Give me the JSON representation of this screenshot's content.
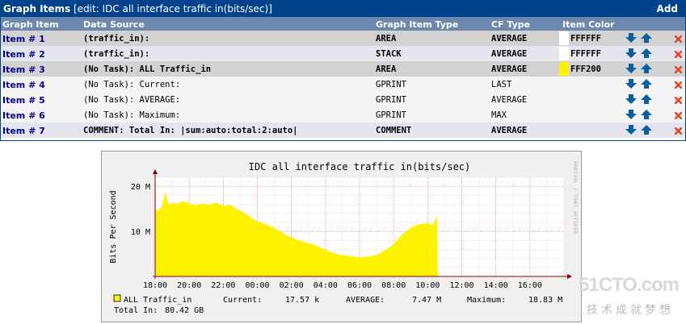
{
  "panel": {
    "title_bold": "Graph Items",
    "title_rest": "[edit: IDC all interface traffic in(bits/sec)]",
    "add_label": "Add",
    "headers": [
      "Graph Item",
      "Data Source",
      "Graph Item Type",
      "CF Type",
      "Item Color"
    ],
    "rows": [
      {
        "item": "Item # 1",
        "ds": "(traffic_in):",
        "type": "AREA",
        "cf": "AVERAGE",
        "color_hex": "FFFFFF",
        "swatch": "#ffffff",
        "bg": "#d2d2d2",
        "bold": true
      },
      {
        "item": "Item # 2",
        "ds": "(traffic_in):",
        "type": "STACK",
        "cf": "AVERAGE",
        "color_hex": "FFFFFF",
        "swatch": "#ffffff",
        "bg": "#e5e5f0",
        "bold": true
      },
      {
        "item": "Item # 3",
        "ds": "(No Task): ALL Traffic_in",
        "type": "AREA",
        "cf": "AVERAGE",
        "color_hex": "FFF200",
        "swatch": "#fff200",
        "bg": "#d2d2d2",
        "bold": true
      },
      {
        "item": "Item # 4",
        "ds": "(No Task): Current:",
        "type": "GPRINT",
        "cf": "LAST",
        "color_hex": "",
        "swatch": "",
        "bg": "#f5f5f5",
        "bold": false
      },
      {
        "item": "Item # 5",
        "ds": "(No Task): AVERAGE:",
        "type": "GPRINT",
        "cf": "AVERAGE",
        "color_hex": "",
        "swatch": "",
        "bg": "#f5f5f5",
        "bold": false
      },
      {
        "item": "Item # 6",
        "ds": "(No Task): Maximum:",
        "type": "GPRINT",
        "cf": "MAX",
        "color_hex": "",
        "swatch": "",
        "bg": "#f5f5f5",
        "bold": false
      },
      {
        "item": "Item # 7",
        "ds": "COMMENT: Total In: |sum:auto:total:2:auto|",
        "type": "COMMENT",
        "cf": "AVERAGE",
        "color_hex": "",
        "swatch": "",
        "bg": "#e5e5f0",
        "bold": true
      }
    ]
  },
  "colors": {
    "title_bg": "#00438c",
    "header_bg": "#6d88ad",
    "arrow": "#0a5fa0",
    "delete": "#e8401c",
    "area": "#fff200"
  },
  "chart_data": {
    "type": "area",
    "title": "IDC all interface traffic in(bits/sec)",
    "ylabel": "Bits Per Second",
    "side_label": "RRDTOOL / TOBI OETIKER",
    "ylim": [
      0,
      22
    ],
    "yticks": [
      {
        "v": 10,
        "label": "10 M"
      },
      {
        "v": 20,
        "label": "20 M"
      }
    ],
    "xlim": [
      0,
      24
    ],
    "xticks": [
      {
        "v": 0,
        "label": "18:00"
      },
      {
        "v": 2,
        "label": "20:00"
      },
      {
        "v": 4,
        "label": "22:00"
      },
      {
        "v": 6,
        "label": "00:00"
      },
      {
        "v": 8,
        "label": "02:00"
      },
      {
        "v": 10,
        "label": "04:00"
      },
      {
        "v": 12,
        "label": "06:00"
      },
      {
        "v": 14,
        "label": "08:00"
      },
      {
        "v": 16,
        "label": "10:00"
      },
      {
        "v": 18,
        "label": "12:00"
      },
      {
        "v": 20,
        "label": "14:00"
      },
      {
        "v": 22,
        "label": "16:00"
      }
    ],
    "x_hours_from_18": [
      0,
      0.2,
      0.4,
      0.6,
      0.8,
      1.0,
      1.3,
      1.6,
      2.0,
      2.4,
      2.8,
      3.2,
      3.6,
      4.0,
      4.4,
      4.8,
      5.2,
      5.6,
      6.0,
      6.5,
      7.0,
      7.5,
      8.0,
      8.5,
      9.0,
      9.5,
      10.0,
      10.5,
      11.0,
      11.5,
      12.0,
      12.5,
      13.0,
      13.5,
      14.0,
      14.5,
      15.0,
      15.5,
      16.0,
      16.3,
      16.55,
      16.6
    ],
    "series": [
      {
        "name": "ALL Traffic_in",
        "values": [
          15.2,
          14.5,
          15.6,
          18.8,
          15.9,
          16.4,
          16.1,
          16.7,
          16.3,
          15.8,
          16.2,
          15.9,
          16.4,
          15.6,
          15.9,
          15.0,
          14.2,
          13.2,
          12.2,
          11.6,
          10.8,
          9.6,
          8.6,
          7.9,
          7.4,
          6.8,
          5.9,
          5.2,
          4.7,
          4.5,
          4.2,
          4.4,
          4.8,
          5.8,
          7.2,
          9.3,
          10.8,
          11.6,
          11.8,
          11.5,
          13.4,
          0
        ]
      }
    ],
    "legend": {
      "series": "ALL Traffic_in",
      "current_label": "Current:",
      "current_value": "17.57 k",
      "average_label": "AVERAGE:",
      "average_value": "7.47 M",
      "maximum_label": "Maximum:",
      "maximum_value": "18.83 M",
      "total_label": "Total In:",
      "total_value": "80.42 GB"
    }
  },
  "watermark": {
    "brand": "51CTO.com",
    "tagline": "技术成就梦想"
  }
}
